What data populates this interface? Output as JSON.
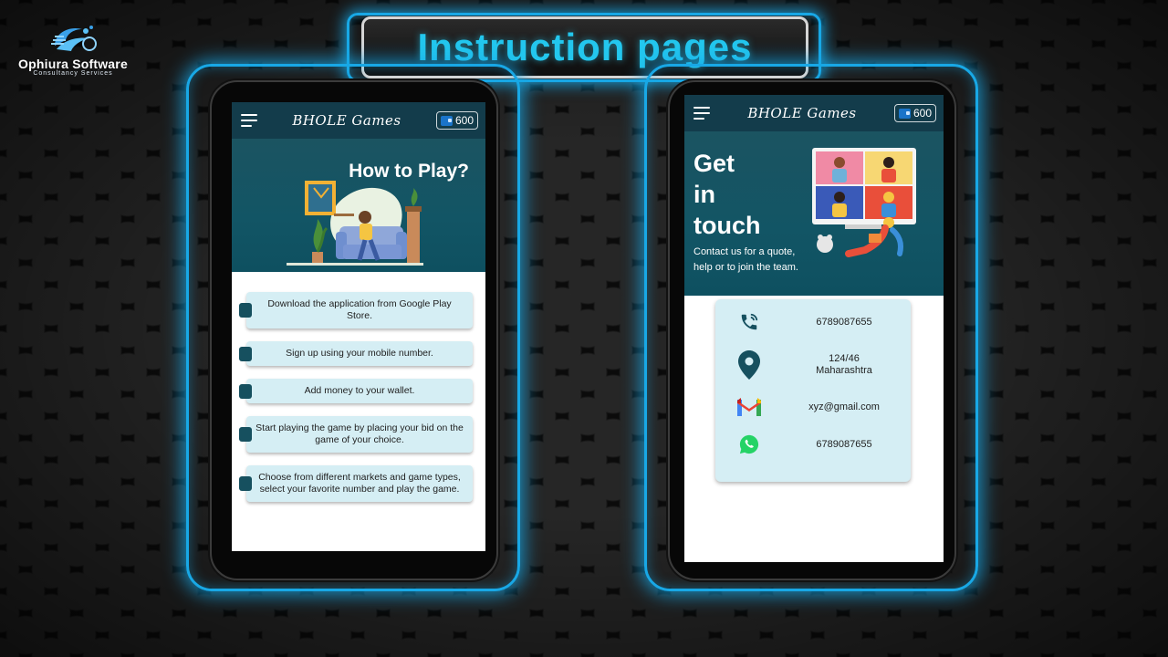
{
  "brand": {
    "name": "Ophiura Software",
    "subtitle": "Consultancy Services"
  },
  "page_title": "Instruction pages",
  "app": {
    "title": "BHOLE Games",
    "wallet_balance": "600"
  },
  "how_to_play": {
    "title": "How to Play?",
    "steps": [
      "Download the application from Google Play Store.",
      "Sign up using your mobile number.",
      "Add money to your wallet.",
      "Start playing the game by placing your bid on the game of your choice.",
      "Choose from different markets and game types, select your favorite number and play the game."
    ]
  },
  "get_in_touch": {
    "title_lines": [
      "Get",
      "in",
      "touch"
    ],
    "subtitle": "Contact us for a quote, help or to join the team.",
    "contacts": [
      {
        "icon": "phone-icon",
        "text": "6789087655"
      },
      {
        "icon": "location-pin-icon",
        "lines": [
          "124/46",
          "Maharashtra"
        ]
      },
      {
        "icon": "gmail-icon",
        "text": "xyz@gmail.com"
      },
      {
        "icon": "whatsapp-icon",
        "text": "6789087655"
      }
    ]
  },
  "colors": {
    "neon": "#18a8e6",
    "title_text": "#23c7ee",
    "app_header": "#133c4b",
    "hero_teal": "#125565",
    "card_bg": "#d5eef4"
  }
}
